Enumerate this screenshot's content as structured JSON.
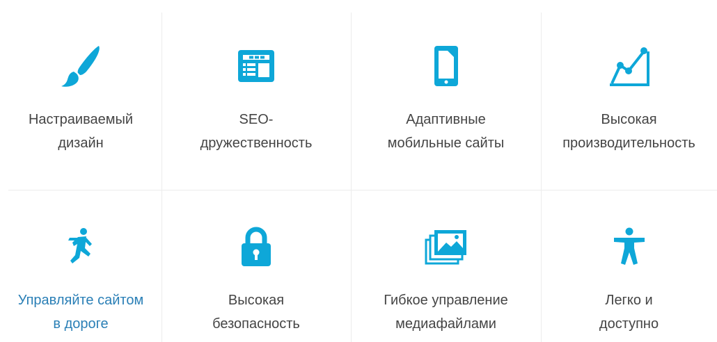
{
  "accent_color": "#0ea7d8",
  "link_color": "#2a7fb6",
  "features": [
    {
      "icon": "paintbrush-icon",
      "line1": "Настраиваемый",
      "line2": "дизайн",
      "link": false
    },
    {
      "icon": "seo-layout-icon",
      "line1": "SEO-",
      "line2": "дружественность",
      "link": false
    },
    {
      "icon": "mobile-phone-icon",
      "line1": "Адаптивные",
      "line2": "мобильные сайты",
      "link": false
    },
    {
      "icon": "line-chart-icon",
      "line1": "Высокая",
      "line2": "производительность",
      "link": false
    },
    {
      "icon": "running-person-icon",
      "line1": "Управляйте сайтом",
      "line2": "в дороге",
      "link": true
    },
    {
      "icon": "padlock-icon",
      "line1": "Высокая",
      "line2": "безопасность",
      "link": false
    },
    {
      "icon": "media-gallery-icon",
      "line1": "Гибкое управление",
      "line2": "медиафайлами",
      "link": false
    },
    {
      "icon": "accessibility-person-icon",
      "line1": "Легко и",
      "line2": "доступно",
      "link": false
    }
  ]
}
